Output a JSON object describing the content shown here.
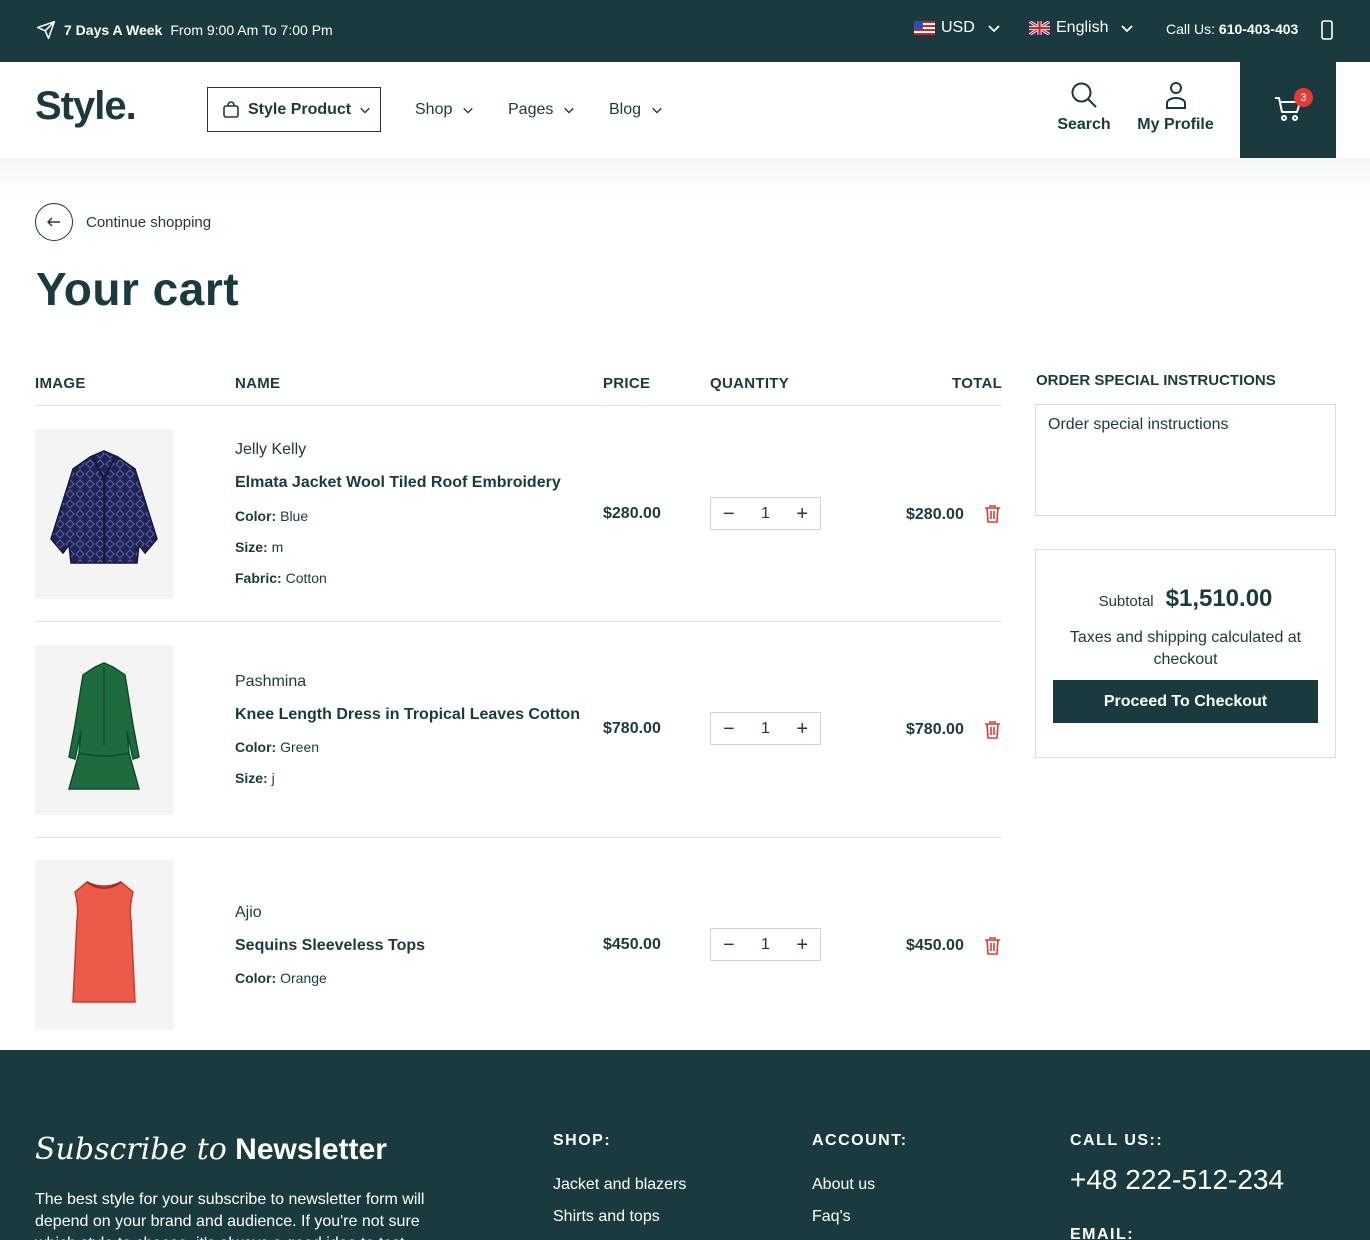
{
  "topbar": {
    "hours_bold": "7 Days A Week",
    "hours_rest": "From 9:00 Am To 7:00 Pm",
    "currency": "USD",
    "language": "English",
    "call_label": "Call Us:",
    "call_number": "610-403-403"
  },
  "header": {
    "logo": "Style.",
    "style_product": "Style Product",
    "nav": [
      "Shop",
      "Pages",
      "Blog"
    ],
    "search_label": "Search",
    "profile_label": "My Profile",
    "cart_count": "3"
  },
  "page": {
    "continue_label": "Continue shopping",
    "title": "Your cart"
  },
  "table": {
    "headers": {
      "image": "IMAGE",
      "name": "NAME",
      "price": "PRICE",
      "quantity": "QUANTITY",
      "total": "TOTAL"
    },
    "items": [
      {
        "vendor": "Jelly Kelly",
        "name": "Elmata Jacket Wool Tiled Roof Embroidery",
        "attrs": [
          {
            "k": "Color:",
            "v": "Blue"
          },
          {
            "k": "Size:",
            "v": "m"
          },
          {
            "k": "Fabric:",
            "v": "Cotton"
          }
        ],
        "price": "$280.00",
        "qty": "1",
        "total": "$280.00"
      },
      {
        "vendor": "Pashmina",
        "name": "Knee Length Dress in Tropical Leaves Cotton",
        "attrs": [
          {
            "k": "Color:",
            "v": "Green"
          },
          {
            "k": "Size:",
            "v": "j"
          }
        ],
        "price": "$780.00",
        "qty": "1",
        "total": "$780.00"
      },
      {
        "vendor": "Ajio",
        "name": "Sequins Sleeveless Tops",
        "attrs": [
          {
            "k": "Color:",
            "v": "Orange"
          }
        ],
        "price": "$450.00",
        "qty": "1",
        "total": "$450.00"
      }
    ]
  },
  "sidebar": {
    "instructions_title": "ORDER SPECIAL INSTRUCTIONS",
    "instructions_placeholder": "Order special instructions",
    "subtotal_label": "Subtotal",
    "subtotal_value": "$1,510.00",
    "tax_note": "Taxes and shipping calculated at checkout",
    "checkout_label": "Proceed To Checkout"
  },
  "footer": {
    "newsletter_italic": "Subscribe to",
    "newsletter_bold": "Newsletter",
    "newsletter_text": "The best style for your subscribe to newsletter form will depend on your brand and audience. If you're not sure which style to choose, it's always a good idea to test",
    "shop_title": "SHOP:",
    "shop_links": [
      "Jacket and blazers",
      "Shirts and tops"
    ],
    "account_title": "ACCOUNT:",
    "account_links": [
      "About us",
      "Faq's"
    ],
    "call_title": "CALL US::",
    "call_number": "+48 222-512-234",
    "email_title": "EMAIL:"
  },
  "colors": {
    "primary": "#1b3a40",
    "badge": "#e53935",
    "trash": "#e53935"
  }
}
